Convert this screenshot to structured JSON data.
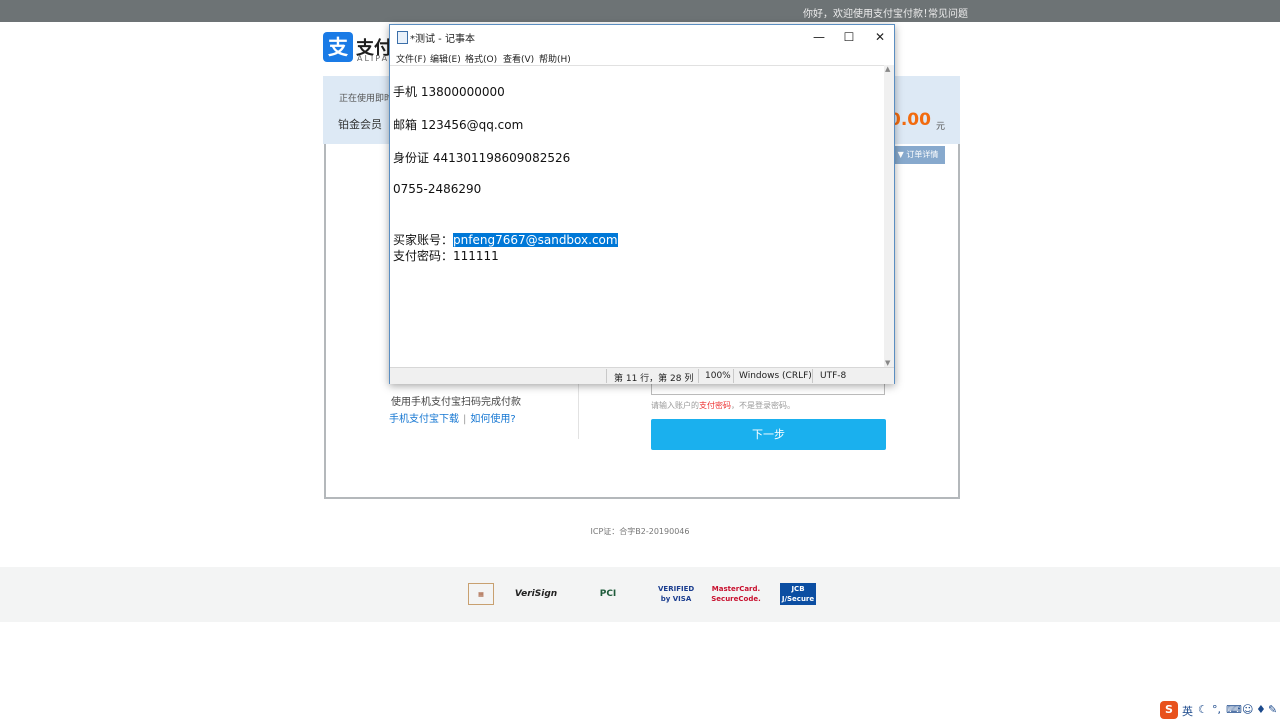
{
  "topbar": {
    "greeting": "你好，欢迎使用支付宝付款！",
    "faq": "常见问题"
  },
  "logo": {
    "glyph": "支",
    "brand": "支付宝",
    "sub": "ALIPAY"
  },
  "order": {
    "using": "正在使用即时到账交易",
    "member": "铂金会员",
    "amount": "0.00",
    "unit": "元",
    "detail": "▼ 订单详情"
  },
  "scan": {
    "text": "使用手机支付宝扫码完成付款",
    "download": "手机支付宝下载",
    "sep": "|",
    "howto": "如何使用?"
  },
  "password": {
    "hint_pre": "请输入账户的",
    "hint_red": "支付密码",
    "hint_post": "，不是登录密码。",
    "next": "下一步"
  },
  "icp": "ICP证：合字B2-20190046",
  "trust_logos": [
    "VeriSign",
    "PCI",
    "VERIFIED by VISA",
    "MasterCard. SecureCode.",
    "JCB J/Secure"
  ],
  "notepad": {
    "title": "*测试 - 记事本",
    "controls": {
      "min": "—",
      "max": "☐",
      "close": "✕"
    },
    "menu": [
      "文件(F)",
      "编辑(E)",
      "格式(O)",
      "查看(V)",
      "帮助(H)"
    ],
    "lines": {
      "phone": "手机 13800000000",
      "email": "邮箱 123456@qq.com",
      "idcard": "身份证 441301198609082526",
      "tel": "0755-2486290",
      "buyer_label": "买家账号：",
      "buyer_value": "pnfeng7667@sandbox.com",
      "paypwd": "支付密码：111111"
    },
    "status": {
      "pos": "第 11 行，第 28 列",
      "zoom": "100%",
      "eol": "Windows (CRLF)",
      "enc": "UTF-8"
    }
  },
  "tray": {
    "app": "S",
    "ime": "英"
  }
}
